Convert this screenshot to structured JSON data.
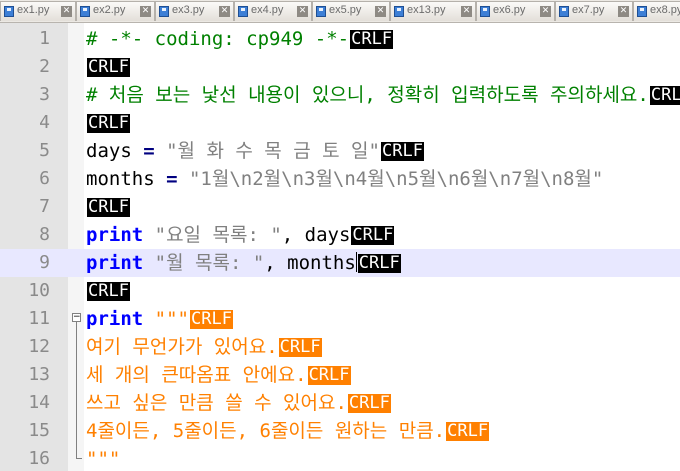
{
  "tabs": [
    {
      "label": "ex1.py"
    },
    {
      "label": "ex2.py"
    },
    {
      "label": "ex3.py"
    },
    {
      "label": "ex4.py"
    },
    {
      "label": "ex5.py"
    },
    {
      "label": "ex13.py"
    },
    {
      "label": "ex6.py"
    },
    {
      "label": "ex7.py"
    },
    {
      "label": "ex8.py"
    }
  ],
  "eol": {
    "cr": "CR",
    "lf": "LF"
  },
  "icons": {
    "tab_file": "python-file-icon",
    "tab_close": "close-icon",
    "fold": "fold-minus-icon"
  },
  "colors": {
    "comment": "#008000",
    "keyword": "#0000ff",
    "string": "#808080",
    "triple_string": "#ff8000",
    "eol_bg": "#000000",
    "eol_bg_string": "#ff8000",
    "current_line": "#e8e8ff"
  },
  "editor": {
    "current_line": 9,
    "lines": [
      {
        "num": "1",
        "text": "# -*- coding: cp949 -*-"
      },
      {
        "num": "2"
      },
      {
        "num": "3",
        "text": "# 처음 보는 낯선 내용이 있으니, 정확히 입력하도록 주의하세요."
      },
      {
        "num": "4"
      },
      {
        "num": "5",
        "ident": "days",
        "op": " = ",
        "str": "\"월 화 수 목 금 토 일\""
      },
      {
        "num": "6",
        "ident": "months",
        "op": " = ",
        "str": "\"1월\\n2월\\n3월\\n4월\\n5월\\n6월\\n7월\\n8월\""
      },
      {
        "num": "7"
      },
      {
        "num": "8",
        "kw": "print",
        "str": " \"요일 목록: \"",
        "rest": ", days"
      },
      {
        "num": "9",
        "kw": "print",
        "str": " \"월 목록: \"",
        "rest": ", months"
      },
      {
        "num": "10"
      },
      {
        "num": "11",
        "kw": "print",
        "str": " \"\"\""
      },
      {
        "num": "12",
        "text": "여기 무언가가 있어요."
      },
      {
        "num": "13",
        "text": "세 개의 큰따옴표 안에요."
      },
      {
        "num": "14",
        "text": "쓰고 싶은 만큼 쓸 수 있어요."
      },
      {
        "num": "15",
        "text": "4줄이든, 5줄이든, 6줄이든 원하는 만큼."
      },
      {
        "num": "16",
        "text": "\"\"\""
      }
    ]
  }
}
